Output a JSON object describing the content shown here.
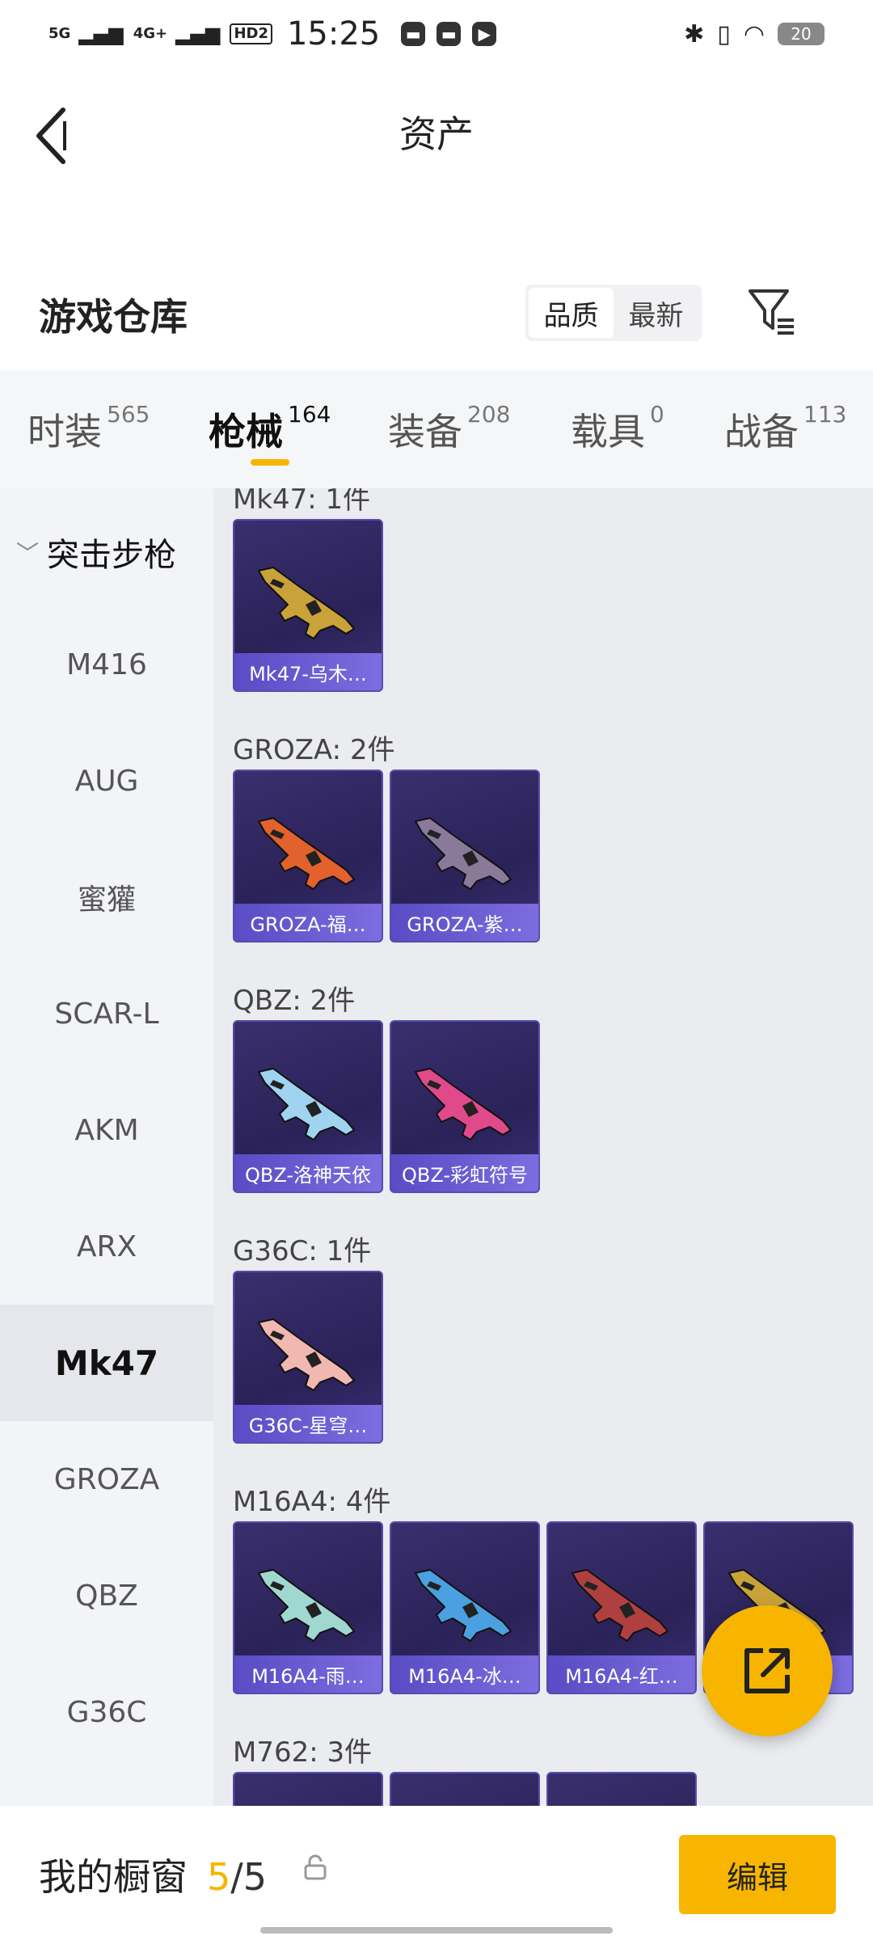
{
  "status_bar": {
    "signal1": "5G",
    "signal2": "4G+",
    "hd": "HD2",
    "time": "15:25",
    "battery": "20"
  },
  "header": {
    "title": "资产"
  },
  "warehouse": {
    "title": "游戏仓库",
    "sort_options": [
      "品质",
      "最新"
    ],
    "sort_selected": "品质"
  },
  "tabs": [
    {
      "label": "时装",
      "count": "565"
    },
    {
      "label": "枪械",
      "count": "164"
    },
    {
      "label": "装备",
      "count": "208"
    },
    {
      "label": "载具",
      "count": "0"
    },
    {
      "label": "战备",
      "count": "113"
    }
  ],
  "sidebar": {
    "category": "突击步枪",
    "items": [
      "M416",
      "AUG",
      "蜜獾",
      "SCAR-L",
      "AKM",
      "ARX",
      "Mk47",
      "GROZA",
      "QBZ",
      "G36C"
    ],
    "selected": "Mk47"
  },
  "groups": [
    {
      "title": "Mk47: 1件",
      "items": [
        {
          "name": "Mk47-乌木…",
          "color": "#c9a33a"
        }
      ]
    },
    {
      "title": "GROZA: 2件",
      "items": [
        {
          "name": "GROZA-福…",
          "color": "#e2612c"
        },
        {
          "name": "GROZA-紫…",
          "color": "#8a7a9a"
        }
      ]
    },
    {
      "title": "QBZ: 2件",
      "items": [
        {
          "name": "QBZ-洛神天依",
          "color": "#9fd3f0"
        },
        {
          "name": "QBZ-彩虹符号",
          "color": "#e04a8a"
        }
      ]
    },
    {
      "title": "G36C: 1件",
      "items": [
        {
          "name": "G36C-星穹…",
          "color": "#f0b8b0"
        }
      ]
    },
    {
      "title": "M16A4: 4件",
      "items": [
        {
          "name": "M16A4-雨…",
          "color": "#9fd8d0"
        },
        {
          "name": "M16A4-冰…",
          "color": "#4aa0e0"
        },
        {
          "name": "M16A4-红…",
          "color": "#b04040"
        },
        {
          "name": "",
          "color": "#c9a33a"
        }
      ]
    },
    {
      "title": "M762: 3件",
      "items": [
        {
          "name": "",
          "color": "#888"
        },
        {
          "name": "",
          "color": "#888"
        },
        {
          "name": "",
          "color": "#888"
        }
      ]
    }
  ],
  "bottom_bar": {
    "label": "我的橱窗",
    "used": "5",
    "total": "/5",
    "edit_label": "编辑"
  },
  "colors": {
    "accent": "#f7b500",
    "card_bg": "#2a2258",
    "card_label": "#6a5ad0"
  }
}
